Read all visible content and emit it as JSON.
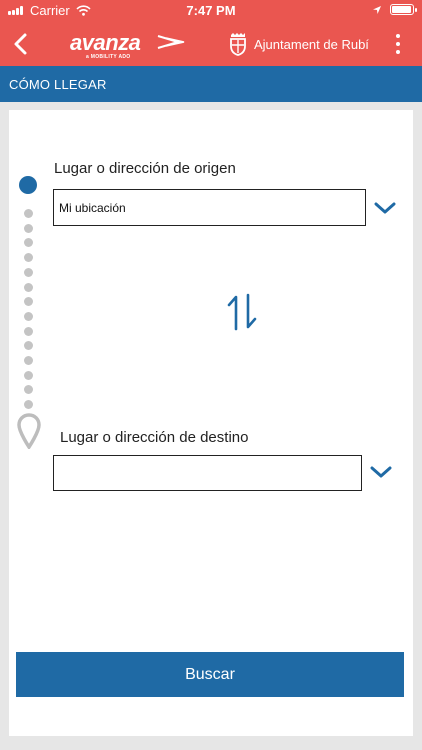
{
  "status_bar": {
    "carrier": "Carrier",
    "time": "7:47 PM",
    "battery_level": 1.0
  },
  "header": {
    "logo_text": "avanza",
    "logo_subtext": "a MOBILITY ADO",
    "city_name": "Ajuntament de Rubí",
    "icons": [
      "back-chevron-icon",
      "city-crest-icon",
      "more-vertical-icon"
    ]
  },
  "section": {
    "title": "CÓMO LLEGAR"
  },
  "route": {
    "origin_label": "Lugar o dirección de origen",
    "origin_value": "Mi ubicación",
    "destination_label": "Lugar o dirección de destino",
    "destination_value": ""
  },
  "search_button_label": "Buscar",
  "colors": {
    "header_red": "#ea5650",
    "primary_blue": "#1f6aa5",
    "dot_gray": "#c4c4c4"
  }
}
